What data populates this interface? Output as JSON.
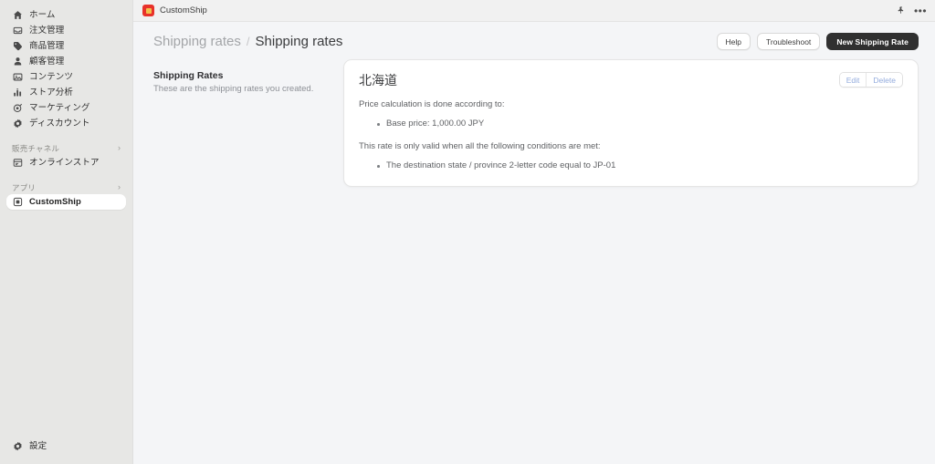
{
  "sidebar": {
    "primary_items": [
      {
        "label": "ホーム",
        "icon": "home-icon"
      },
      {
        "label": "注文管理",
        "icon": "orders-icon"
      },
      {
        "label": "商品管理",
        "icon": "products-tag-icon"
      },
      {
        "label": "顧客管理",
        "icon": "customers-person-icon"
      },
      {
        "label": "コンテンツ",
        "icon": "content-media-icon"
      },
      {
        "label": "ストア分析",
        "icon": "analytics-bars-icon"
      },
      {
        "label": "マーケティング",
        "icon": "marketing-target-icon"
      },
      {
        "label": "ディスカウント",
        "icon": "discount-gear-icon"
      }
    ],
    "sales_channel": {
      "title": "販売チャネル",
      "items": [
        {
          "label": "オンラインストア",
          "icon": "online-store-icon"
        }
      ]
    },
    "apps": {
      "title": "アプリ",
      "items": [
        {
          "label": "CustomShip",
          "icon": "app-square-icon",
          "active": true
        }
      ]
    },
    "settings": {
      "label": "設定",
      "icon": "gear-icon"
    }
  },
  "appbar": {
    "app_name": "CustomShip",
    "pin_icon": "pin-icon",
    "more_icon": "more-horizontal-icon"
  },
  "page_header": {
    "breadcrumb_parent": "Shipping rates",
    "breadcrumb_separator": "/",
    "breadcrumb_current": "Shipping rates",
    "buttons": {
      "help": "Help",
      "troubleshoot": "Troubleshoot",
      "new_shipping_rate": "New Shipping Rate"
    }
  },
  "description": {
    "title": "Shipping Rates",
    "body": "These are the shipping rates you created."
  },
  "rate_card": {
    "title": "北海道",
    "edit_label": "Edit",
    "delete_label": "Delete",
    "price_intro": "Price calculation is done according to:",
    "price_items": [
      "Base price: 1,000.00 JPY"
    ],
    "conditions_intro": "This rate is only valid when all the following conditions are met:",
    "condition_items": [
      "The destination state / province 2-letter code equal to JP-01"
    ]
  },
  "colors": {
    "sidebar_bg": "#e7e7e5",
    "page_bg": "#f4f5f7",
    "primary_button_bg": "#303030",
    "app_badge": "#e8322a",
    "link_blue": "#93abdd"
  }
}
